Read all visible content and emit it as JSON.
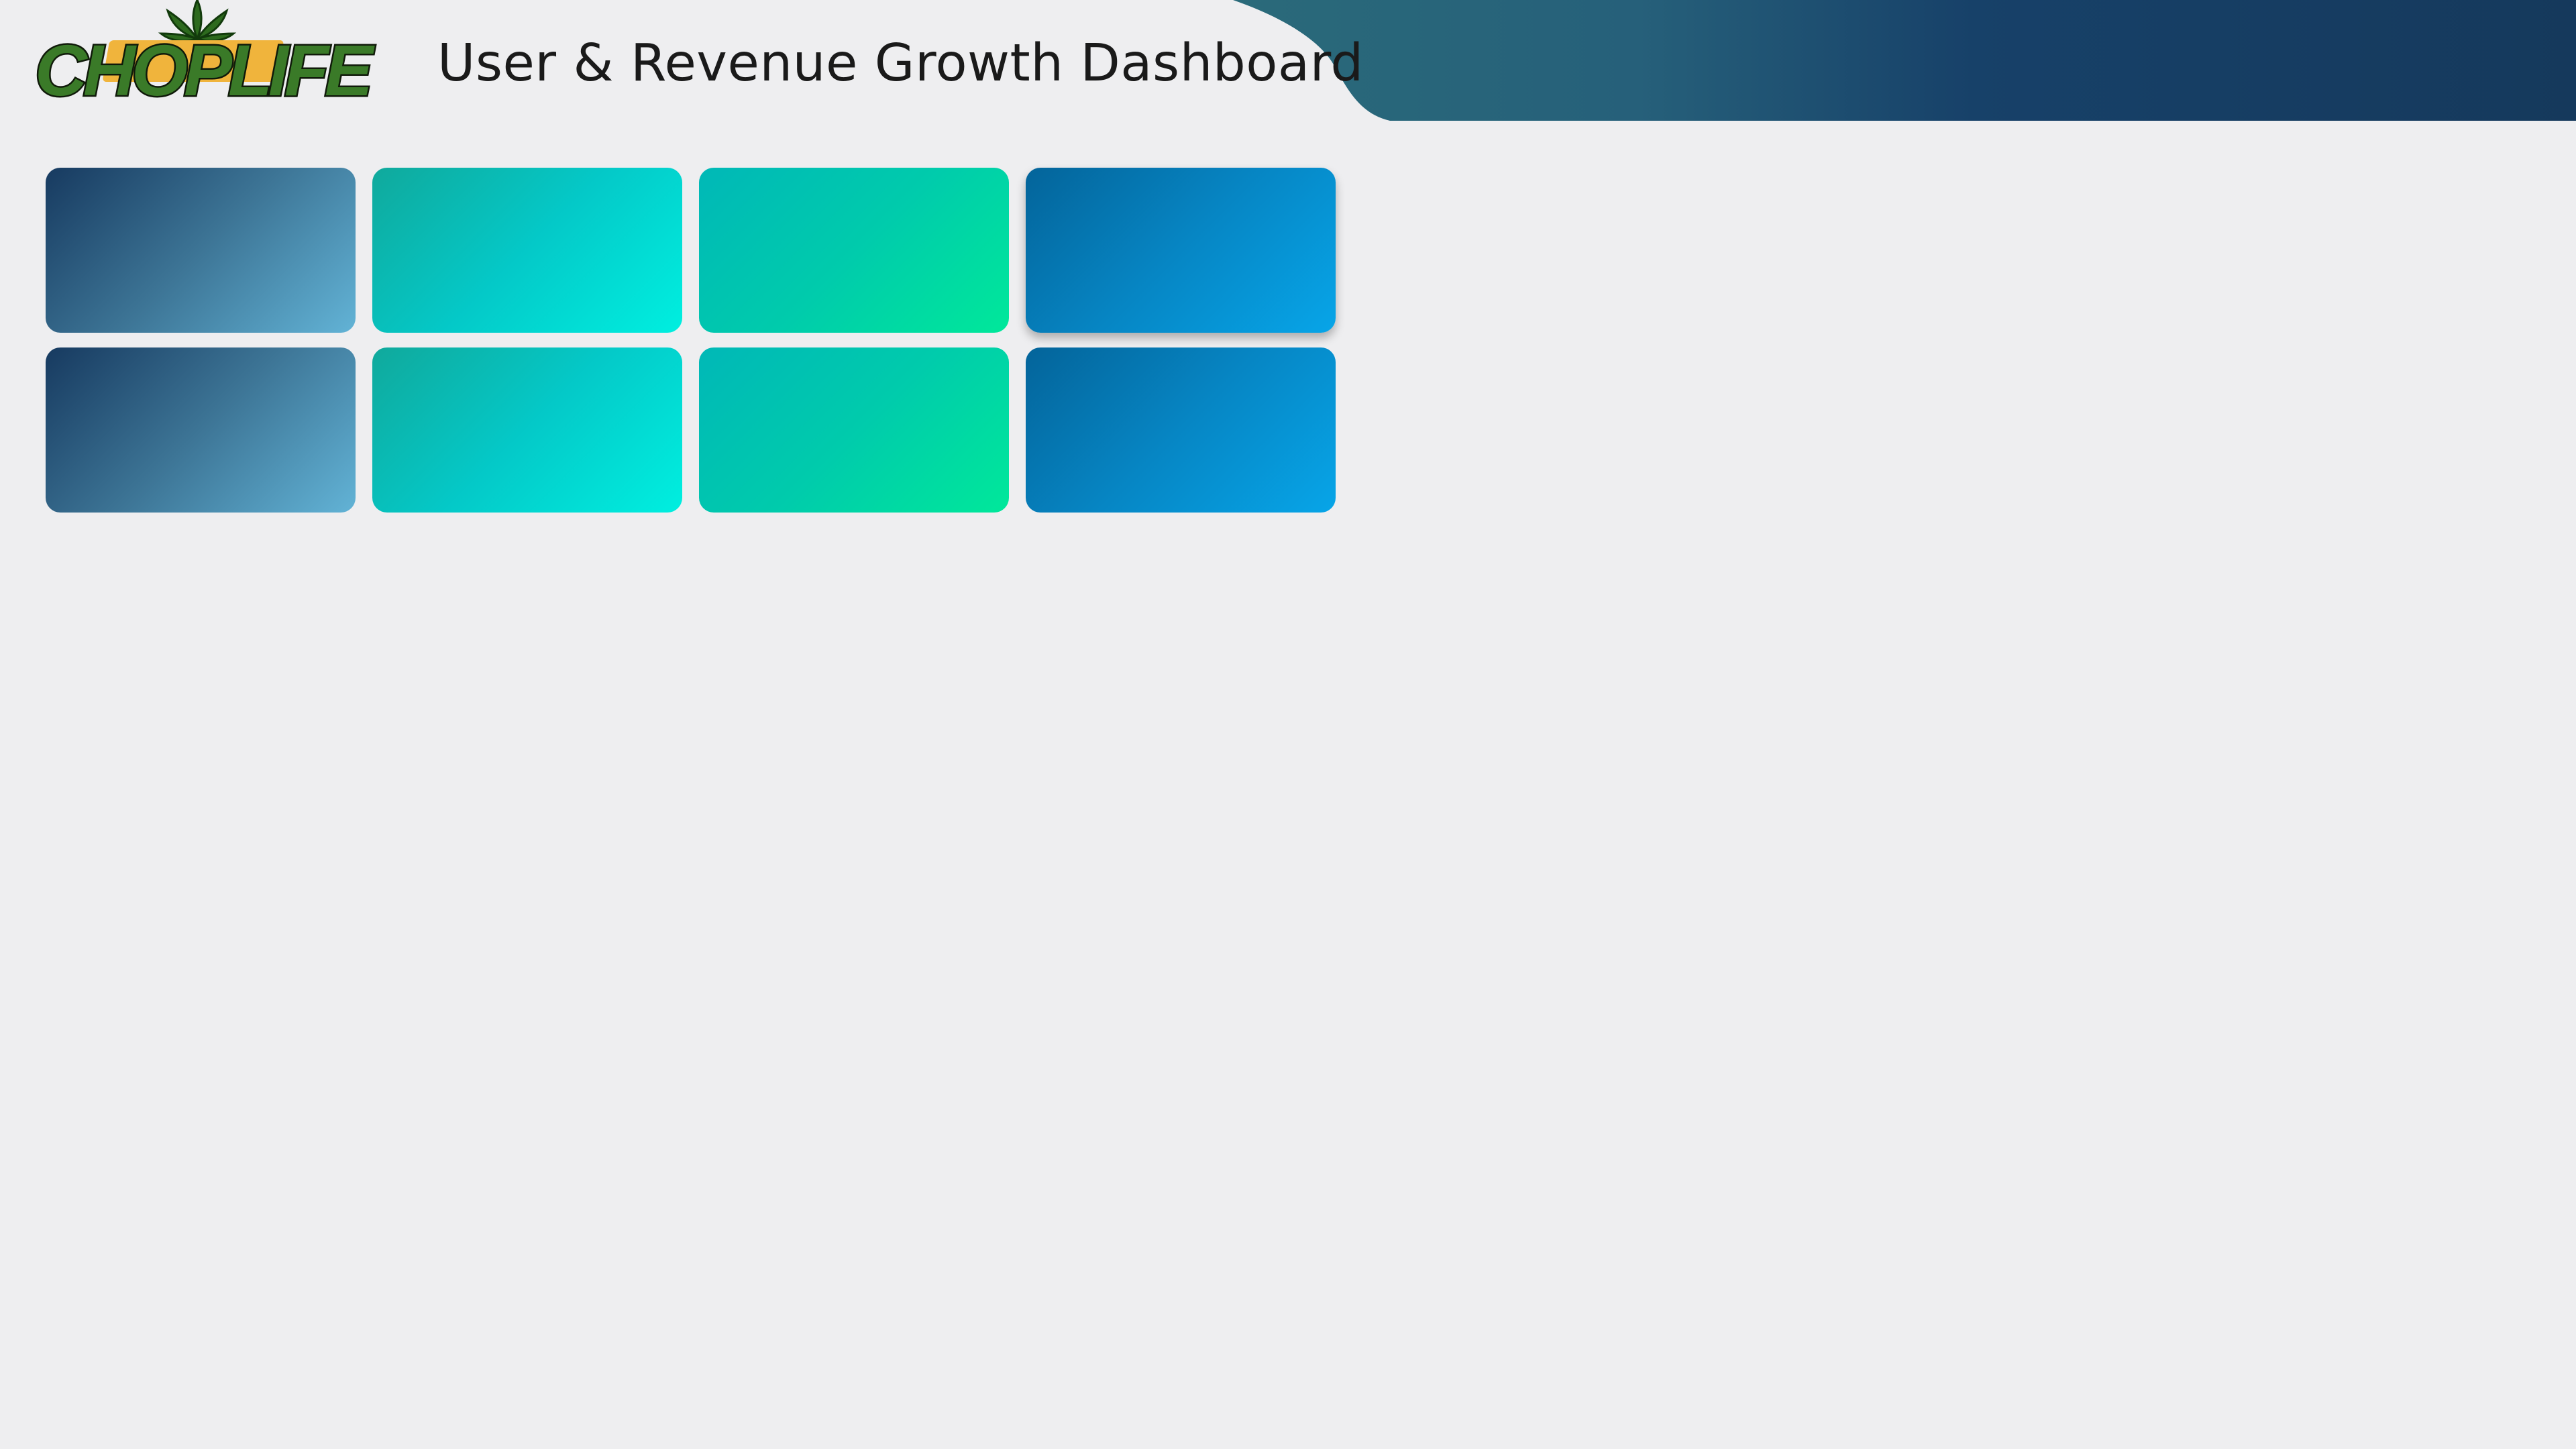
{
  "header": {
    "title": "User & Revenue Growth Dashboard",
    "logo_text": "CHOPLIFE",
    "logo_icon": "cannabis-leaf-icon",
    "banner_colors": [
      "#2a6a7a",
      "#15395c"
    ]
  },
  "tiles": {
    "rows": 2,
    "columns": 4,
    "gradients": [
      {
        "name": "navy",
        "colors": [
          "#173a60",
          "#62b3d6"
        ]
      },
      {
        "name": "teal",
        "colors": [
          "#10a99c",
          "#00efe0"
        ]
      },
      {
        "name": "green",
        "colors": [
          "#00b8b7",
          "#00e89a"
        ]
      },
      {
        "name": "blue",
        "colors": [
          "#04649a",
          "#07a5e8"
        ]
      }
    ]
  },
  "background_color": "#eeeef0"
}
